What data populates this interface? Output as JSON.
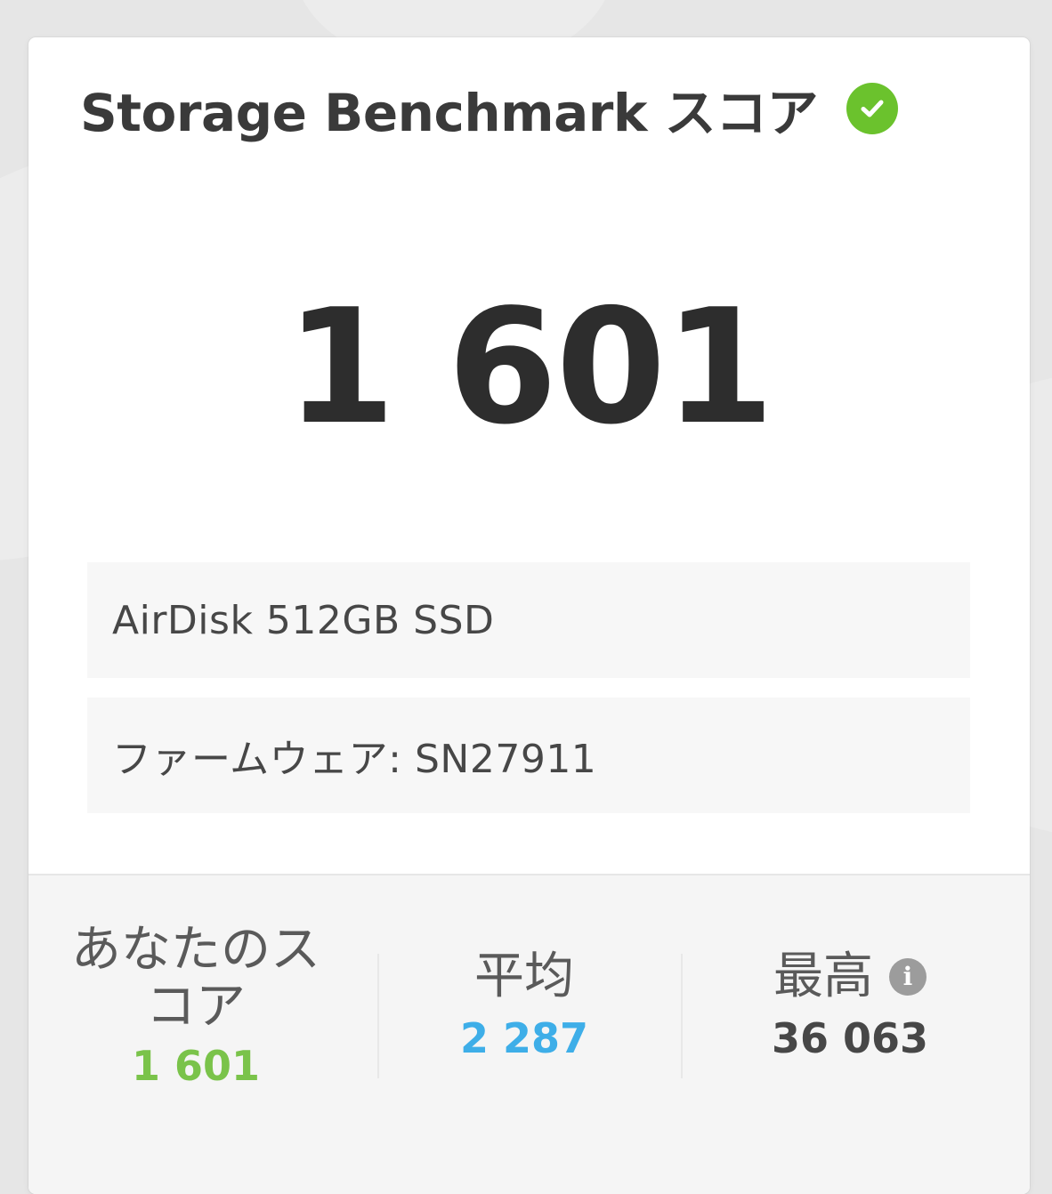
{
  "card": {
    "title": "Storage Benchmark スコア",
    "status_icon": "check-circle-icon",
    "main_score": "1 601",
    "device_name": "AirDisk 512GB SSD",
    "firmware": "ファームウェア: SN27911"
  },
  "stats": {
    "your_score": {
      "label_line1": "あなたのス",
      "label_line2": "コア",
      "value": "1 601"
    },
    "average": {
      "label": "平均",
      "value": "2 287"
    },
    "best": {
      "label": "最高",
      "value": "36 063",
      "info_icon_text": "i"
    }
  },
  "colors": {
    "success": "#6bc22d",
    "your_score": "#7ac34a",
    "average": "#3eaee8",
    "text": "#3a3a3a"
  }
}
